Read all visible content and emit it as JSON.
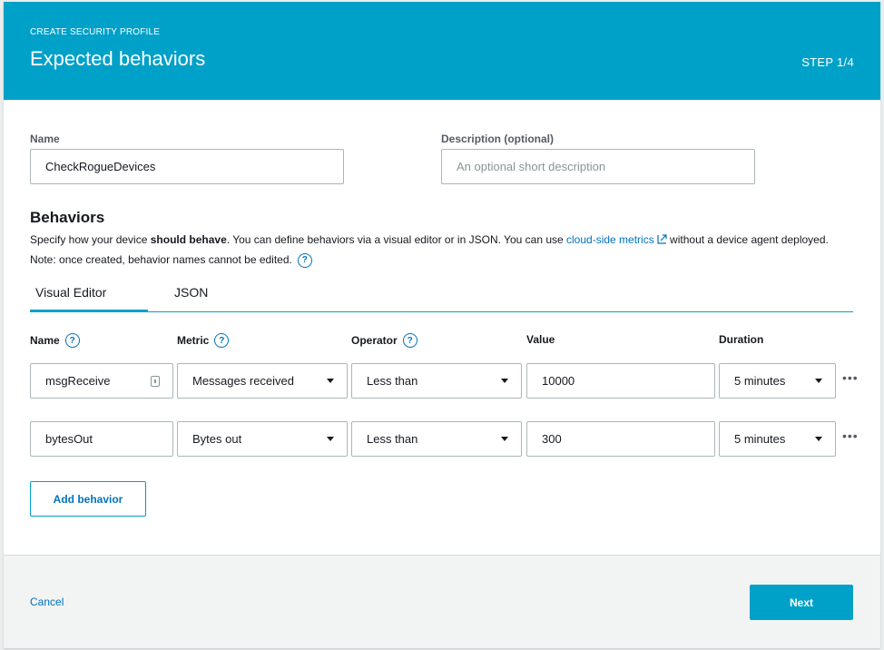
{
  "header": {
    "eyebrow": "CREATE SECURITY PROFILE",
    "title": "Expected behaviors",
    "step": "STEP 1/4"
  },
  "form": {
    "name_label": "Name",
    "name_value": "CheckRogueDevices",
    "description_label": "Description (optional)",
    "description_placeholder": "An optional short description"
  },
  "behaviors": {
    "title": "Behaviors",
    "desc_part1": "Specify how your device ",
    "desc_bold": "should behave",
    "desc_part2": ". You can define behaviors via a visual editor or in JSON. You can use ",
    "desc_link": "cloud-side metrics",
    "desc_part3": " without a device agent deployed. Note: once created, behavior names cannot be edited.",
    "tabs": [
      "Visual Editor",
      "JSON"
    ],
    "columns": {
      "name": "Name",
      "metric": "Metric",
      "operator": "Operator",
      "value": "Value",
      "duration": "Duration"
    },
    "rows": [
      {
        "name": "msgReceive",
        "metric": "Messages received",
        "operator": "Less than",
        "value": "10000",
        "duration": "5 minutes"
      },
      {
        "name": "bytesOut",
        "metric": "Bytes out",
        "operator": "Less than",
        "value": "300",
        "duration": "5 minutes"
      }
    ],
    "add_label": "Add behavior"
  },
  "footer": {
    "cancel": "Cancel",
    "next": "Next"
  },
  "colors": {
    "accent": "#00a1c9",
    "link": "#0073bb"
  }
}
